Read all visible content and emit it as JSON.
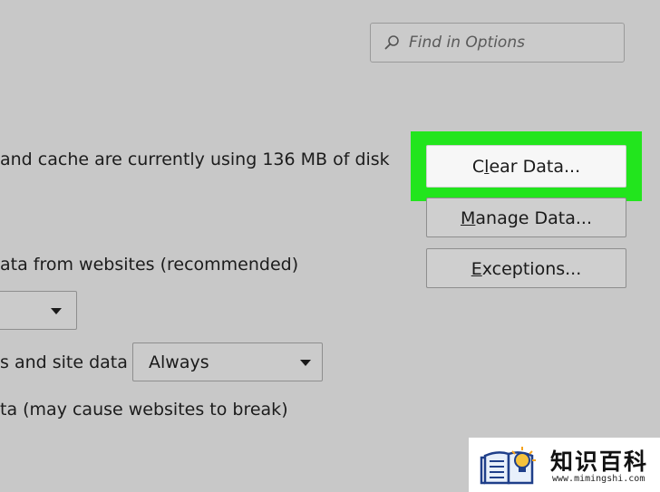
{
  "search": {
    "placeholder": "Find in Options",
    "icon": "search-icon"
  },
  "cookies_section": {
    "usage_text": "and cache are currently using 136 MB of disk",
    "accept_text": "ata from websites (recommended)",
    "keep_until_label": "s and site data",
    "keep_until_value": "Always",
    "block_text": "ta (may cause websites to break)"
  },
  "buttons": {
    "clear_data": {
      "underlined": "l",
      "before": "C",
      "after": "ear Data..."
    },
    "manage_data": {
      "underlined": "M",
      "before": "",
      "after": "anage Data..."
    },
    "exceptions": {
      "underlined": "E",
      "before": "",
      "after": "xceptions..."
    }
  },
  "highlight_color": "#22e51d",
  "watermark": {
    "title": "知识百科",
    "url": "www.mimingshi.com"
  }
}
